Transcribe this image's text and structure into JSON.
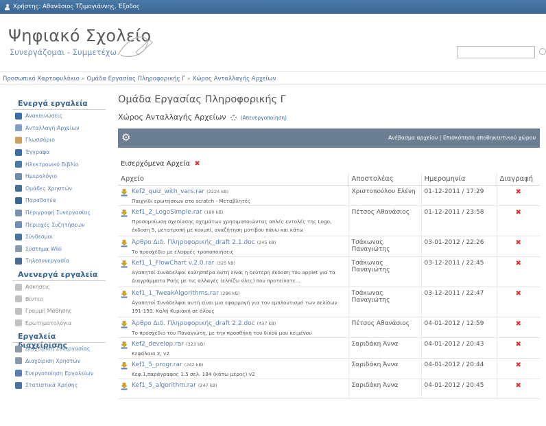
{
  "topbar": {
    "user_label": "Χρήστης: Αθανάσιος Τζιμογιάννης, Έξοδος"
  },
  "header": {
    "title": "Ψηφιακό Σχολείο",
    "subtitle": "Συνεργάζομαι - Συμμετέχω",
    "search_value": ""
  },
  "breadcrumb": {
    "items": [
      "Προσωπικό Χαρτοφυλάκιο",
      "Ομάδα Εργασίας Πληροφορικής Γ",
      "Χώρος Ανταλλαγής Αρχείων"
    ],
    "separator": "»"
  },
  "sidebar": {
    "active_heading": "Ενεργά εργαλεία",
    "active_items": [
      {
        "label": "Ανακοινώσεις",
        "icon": "announcements-icon",
        "color": "#3b6ea5"
      },
      {
        "label": "Ανταλλαγή Αρχείων",
        "icon": "file-exchange-icon",
        "color": "#7fa0c8"
      },
      {
        "label": "Γλωσσάριο",
        "icon": "glossary-icon",
        "color": "#c8a060"
      },
      {
        "label": "Έγγραφα",
        "icon": "documents-icon",
        "color": "#3d6f9e"
      },
      {
        "label": "Ηλεκτρονικό Βιβλίο",
        "icon": "ebook-icon",
        "color": "#4a7aa8"
      },
      {
        "label": "Ημερολόγιο",
        "icon": "calendar-icon",
        "color": "#6d8db0"
      },
      {
        "label": "Ομάδες Χρηστών",
        "icon": "user-groups-icon",
        "color": "#4a6f96"
      },
      {
        "label": "Παραδοτέα",
        "icon": "deliverables-icon",
        "color": "#3a6592"
      },
      {
        "label": "Περιγραφή Συνεργασίας",
        "icon": "description-icon",
        "color": "#7a90b0"
      },
      {
        "label": "Περιοχές Συζητήσεων",
        "icon": "forum-icon",
        "color": "#6f8fb5"
      },
      {
        "label": "Σύνδεσμοι",
        "icon": "links-icon",
        "color": "#4a74a0"
      },
      {
        "label": "Σύστημα Wiki",
        "icon": "wiki-icon",
        "color": "#8a9bb0"
      },
      {
        "label": "Τηλεσυνεργασία",
        "icon": "teleconference-icon",
        "color": "#4a6a90"
      }
    ],
    "inactive_heading": "Ανενεργά εργαλεία",
    "inactive_items": [
      {
        "label": "Ασκήσεις",
        "icon": "exercises-icon",
        "color": "#999999"
      },
      {
        "label": "Βίντεο",
        "icon": "video-icon",
        "color": "#999999"
      },
      {
        "label": "Γραμμή Μάθησης",
        "icon": "learning-path-icon",
        "color": "#999999"
      },
      {
        "label": "Ερωτηματολόγια",
        "icon": "questionnaire-icon",
        "color": "#999999"
      }
    ],
    "admin_heading": "Εργαλεία διαχείρισης",
    "admin_items": [
      {
        "label": "Διαχείριση Συνεργασίας",
        "icon": "tools-icon",
        "color": "#8899aa"
      },
      {
        "label": "Διαχείριση Χρηστών",
        "icon": "users-admin-icon",
        "color": "#8899aa"
      },
      {
        "label": "Ενεργοποίηση Εργαλείων",
        "icon": "activate-tools-icon",
        "color": "#5a7fb0"
      },
      {
        "label": "Στατιστικά Χρήσης",
        "icon": "statistics-icon",
        "color": "#4a74a0"
      }
    ]
  },
  "main": {
    "group_title": "Ομάδα Εργασίας Πληροφορικής Γ",
    "area_title": "Χώρος Ανταλλαγής Αρχείων",
    "deactivate_label": "(Απενεργοποίηση)",
    "toolbar": {
      "upload_label": "Ανέβασμα αρχείου",
      "separator": "|",
      "storage_label": "Επισκόπηση αποθηκευτικού χώρου"
    },
    "incoming_label": "Εισερχόμενα Αρχεία",
    "columns": [
      "Αρχείο",
      "Αποστολέας",
      "Ημερομηνία",
      "Διαγραφή"
    ],
    "files": [
      {
        "name": "Kef2_quiz_with_vars.rar",
        "size": "(2224 kB)",
        "desc": "Παιχνίδι ερωτήσεων στο scratch - Μεταβλητές",
        "sender": "Χριστοπούλου Ελένη",
        "date": "01-12-2011 / 17:29",
        "rows": 1
      },
      {
        "name": "Kef1_2_LogoSimple.rar",
        "size": "(190 kB)",
        "desc": "Προσομοίωση σχεδίασης σχημάτων χρησιμοποιώντας απλές εντολές της Logo, έκδοση 5, μετατροπή με κουμπί, αναζήτηση μοτίβου πάνω και κάτω",
        "sender": "Πέτσος Αθανάσιος",
        "date": "01-12-2011 / 23:58",
        "rows": 2
      },
      {
        "name": "Άρθρο Διδ. Πληροφορικής_draft 2.1.doc",
        "size": "(245 kB)",
        "desc": "Το προσχέδιο με ελαφρές τροποποιήσεις",
        "sender": "Τσάκωνας Παναγιώτης",
        "date": "03-01-2012 / 22:26",
        "rows": 1
      },
      {
        "name": "Kef1_1_FlowChart v.2.0.rar",
        "size": "(325 kB)",
        "desc": "Αγαπητοί Συνάδελφοι καλησπέρα Αυτή είναι η δεύτερη έκδοση του applet για τα Διαγράμματα Ροής με τις αλλαγές (ελπίζω όλες) που προτείνατε...",
        "sender": "Τσάκωνας Παναγιώτης",
        "date": "03-12-2011 / 22:45",
        "rows": 2
      },
      {
        "name": "Kef1_1_TweakAlgorithms.rar",
        "size": "(286 kB)",
        "desc": "Αγαπητοί Συνάδελφοι αυτή είναι μια εφαρμογή για τον εμπλουτισμό των σελίδων 191-193. Καλή Κυριακή σε όλους",
        "sender": "Τσάκωνας Παναγιώτης",
        "date": "03-12-2011 / 22:47",
        "rows": 2
      },
      {
        "name": "Άρθρο Διδ. Πληροφορικής_draft 2.2.doc",
        "size": "(437 kB)",
        "desc": "Το προσχέδιο του Παναγιώτη, με την προσθήκη του δικού μου κειμένου",
        "sender": "Πέτσος Αθανάσιος",
        "date": "04-01-2012 / 12:59",
        "rows": 1
      },
      {
        "name": "Kef2_develop.rar",
        "size": "(323 kB)",
        "desc": "Κεφάλαιο 2, v2",
        "sender": "Σαριδάκη Άννα",
        "date": "04-01-2012 / 20:43",
        "rows": 1
      },
      {
        "name": "Kef1_5_progr.rar",
        "size": "(242 kB)",
        "desc": "Κεφ.1,παράγραφος 1.5 σελ. 184 (κάτω μέρος) v2",
        "sender": "Σαριδάκη Άννα",
        "date": "04-01-2012 / 20:44",
        "rows": 1
      },
      {
        "name": "Kef1_5_algorithm.rar",
        "size": "(247 kB)",
        "desc": "",
        "sender": "Σαριδάκη Άννα",
        "date": "04-01-2012 / 20:45",
        "rows": 1
      }
    ],
    "delete_glyph": "✖"
  },
  "colors": {
    "topbar": "#3f6b97",
    "toolbar": "#6c7f92",
    "link": "#5a7fb0",
    "delete": "#dd3333",
    "upload_icon": "#c9a227"
  }
}
